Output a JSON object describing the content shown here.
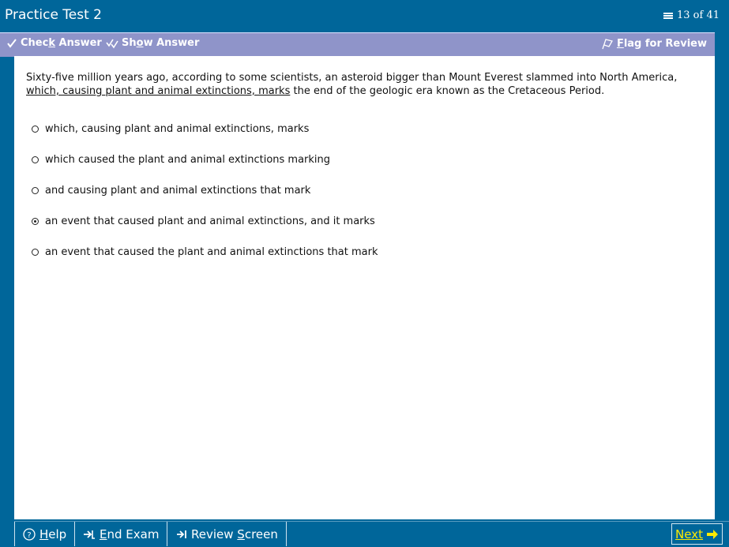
{
  "header": {
    "title": "Practice Test 2",
    "counter": "13 of 41"
  },
  "toolbar": {
    "check_answer": {
      "pre": "Chec",
      "u": "k",
      "post": " Answer"
    },
    "show_answer": {
      "pre": "Sh",
      "u": "o",
      "post": "w Answer"
    },
    "flag_review": {
      "pre": "",
      "u": "F",
      "post": "lag for Review"
    }
  },
  "question": {
    "before": "Sixty-five million years ago, according to some scientists, an asteroid bigger than Mount Everest slammed into North America, ",
    "underlined": "which, causing plant and animal extinctions, marks",
    "after": " the end of the geologic era known as the Cretaceous Period."
  },
  "choices": [
    {
      "label": "which, causing plant and animal extinctions, marks",
      "selected": false
    },
    {
      "label": "which caused the plant and animal extinctions marking",
      "selected": false
    },
    {
      "label": "and causing plant and animal extinctions that mark",
      "selected": false
    },
    {
      "label": "an event that caused plant and animal extinctions, and it marks",
      "selected": true
    },
    {
      "label": "an event that caused the plant and animal extinctions that mark",
      "selected": false
    }
  ],
  "footer": {
    "help": {
      "pre": "",
      "u": "H",
      "post": "elp"
    },
    "end_exam": {
      "pre": "",
      "u": "E",
      "post": "nd Exam"
    },
    "review_screen": {
      "pre": "Review ",
      "u": "S",
      "post": "creen"
    },
    "next": "Next"
  },
  "colors": {
    "frame": "#00669a",
    "toolbar": "#8f94c9",
    "next_text": "#ffea00"
  },
  "icons": {
    "counter": "questions-stack-icon",
    "check": "check-answer-icon",
    "show": "show-answer-icon",
    "flag": "flag-icon",
    "help": "help-icon",
    "end": "end-exam-icon",
    "review": "review-screen-icon",
    "next": "arrow-right-icon"
  }
}
